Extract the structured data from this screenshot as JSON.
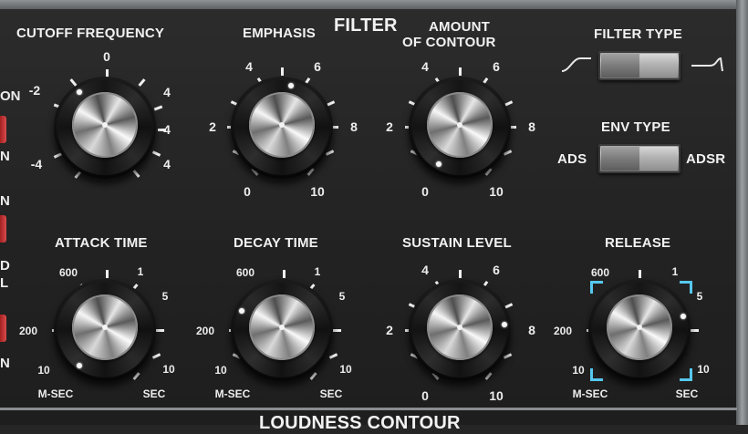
{
  "filter_section": {
    "title": "FILTER",
    "cutoff": {
      "label": "CUTOFF FREQUENCY",
      "ticks": [
        "0",
        "4",
        "4",
        "4",
        "-4",
        "-2"
      ]
    },
    "emphasis": {
      "label": "EMPHASIS",
      "ticks": [
        "4",
        "6",
        "2",
        "8",
        "0",
        "10"
      ]
    },
    "contour": {
      "label_line1": "AMOUNT",
      "label_line2": "OF CONTOUR",
      "ticks": [
        "4",
        "6",
        "2",
        "8",
        "0",
        "10"
      ]
    },
    "filter_type": {
      "label": "FILTER TYPE"
    },
    "env_type": {
      "label": "ENV TYPE",
      "left": "ADS",
      "right": "ADSR"
    }
  },
  "envelope": {
    "attack": {
      "label": "ATTACK TIME",
      "ticks": [
        "600",
        "1",
        "5",
        "200",
        "10",
        "10",
        "M-SEC",
        "SEC"
      ]
    },
    "decay": {
      "label": "DECAY TIME",
      "ticks": [
        "600",
        "1",
        "5",
        "200",
        "10",
        "10",
        "M-SEC",
        "SEC"
      ]
    },
    "sustain": {
      "label": "SUSTAIN LEVEL",
      "ticks": [
        "4",
        "6",
        "2",
        "8",
        "0",
        "10"
      ]
    },
    "release": {
      "label": "RELEASE",
      "ticks": [
        "600",
        "1",
        "5",
        "200",
        "10",
        "10",
        "M-SEC",
        "SEC"
      ]
    }
  },
  "left_edge": {
    "t1": "ON",
    "t2": "N",
    "t3": "N",
    "t4": "D",
    "t5": "L",
    "t6": "N"
  },
  "bottom": {
    "title": "LOUDNESS CONTOUR"
  },
  "colors": {
    "accent": "#56c8ee",
    "led": "#c83a3a",
    "panel": "#262626"
  }
}
